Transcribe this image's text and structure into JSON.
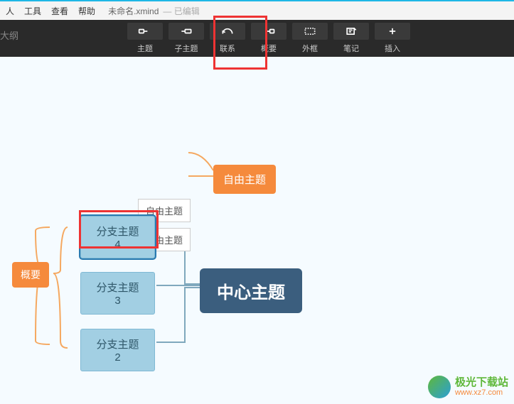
{
  "titlebar": {
    "menu": [
      "人",
      "工具",
      "查看",
      "帮助"
    ],
    "filename": "未命名.xmind",
    "edited": "— 已编辑"
  },
  "toolbar": {
    "outline": "大纲",
    "items": [
      {
        "id": "topic",
        "label": "主题"
      },
      {
        "id": "subtopic",
        "label": "子主题"
      },
      {
        "id": "relation",
        "label": "联系"
      },
      {
        "id": "summary",
        "label": "概要"
      },
      {
        "id": "boundary",
        "label": "外框"
      },
      {
        "id": "note",
        "label": "笔记"
      },
      {
        "id": "insert",
        "label": "插入"
      }
    ]
  },
  "canvas": {
    "free_topic_texts": [
      "自由主题",
      "自由主题"
    ],
    "free_topic_main": "自由主题",
    "summary_label": "概要",
    "branches": [
      "分支主题 4",
      "分支主题 3",
      "分支主题 2"
    ],
    "central": "中心主题"
  },
  "watermark": {
    "name": "极光下载站",
    "url": "www.xz7.com"
  }
}
